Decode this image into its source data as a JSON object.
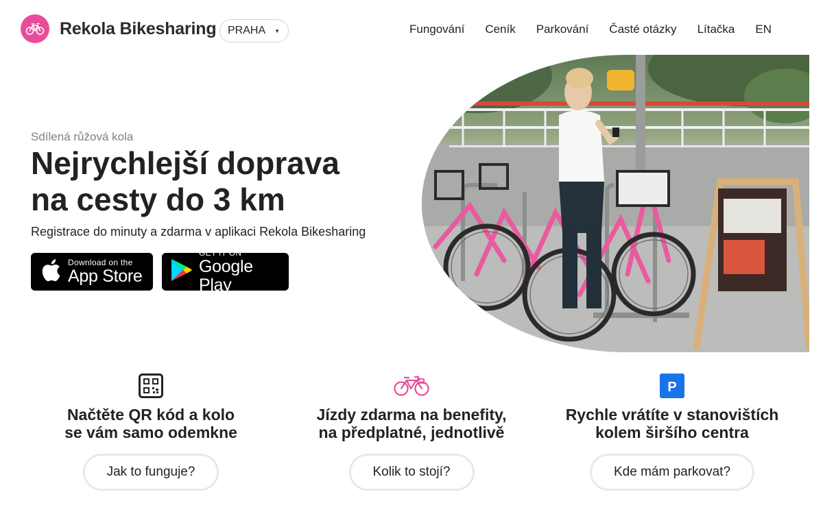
{
  "header": {
    "brand": "Rekola Bikesharing",
    "city": "PRAHA",
    "nav": [
      "Fungování",
      "Ceník",
      "Parkování",
      "Časté otázky",
      "Lítačka",
      "EN"
    ]
  },
  "hero": {
    "kicker": "Sdílená růžová kola",
    "title_line1": "Nejrychlejší doprava",
    "title_line2": "na cesty do 3 km",
    "subtitle": "Registrace do minuty a zdarma v aplikaci Rekola Bikesharing",
    "app_store": {
      "small": "Download on the",
      "big": "App Store"
    },
    "google_play": {
      "small": "GET IT ON",
      "big": "Google Play"
    }
  },
  "features": [
    {
      "icon": "qr-code-icon",
      "line1": "Načtěte QR kód a kolo",
      "line2": "se vám samo odemkne",
      "button": "Jak to funguje?"
    },
    {
      "icon": "bicycle-icon",
      "line1": "Jízdy zdarma na benefity,",
      "line2": "na předplatné, jednotlivě",
      "button": "Kolik to stojí?"
    },
    {
      "icon": "parking-icon",
      "line1": "Rychle vrátíte v stanovištích",
      "line2": "kolem širšího centra",
      "button": "Kde mám parkovat?"
    }
  ],
  "colors": {
    "brand_pink": "#e94c9b",
    "parking_blue": "#1a73e8"
  }
}
